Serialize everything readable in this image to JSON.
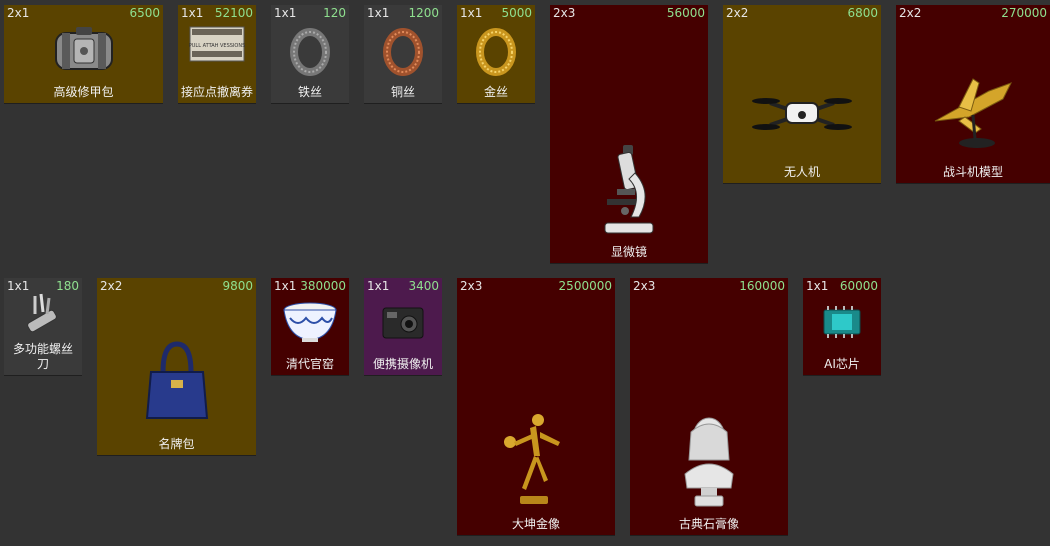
{
  "items": [
    {
      "id": "armor-repair-kit",
      "size": "2x1",
      "price": "6500",
      "name": "高级修甲包",
      "tier": "gold",
      "icon": "armor-repair-kit-icon"
    },
    {
      "id": "extraction-voucher",
      "size": "1x1",
      "price": "52100",
      "name": "接应点撤离券",
      "tier": "gold",
      "icon": "voucher-icon",
      "icon_text": "PULL ATTAH VESSIONS"
    },
    {
      "id": "iron-wire",
      "size": "1x1",
      "price": "120",
      "name": "铁丝",
      "tier": "gray",
      "icon": "iron-wire-icon"
    },
    {
      "id": "copper-wire",
      "size": "1x1",
      "price": "1200",
      "name": "铜丝",
      "tier": "gray",
      "icon": "copper-wire-icon"
    },
    {
      "id": "gold-wire",
      "size": "1x1",
      "price": "5000",
      "name": "金丝",
      "tier": "gold",
      "icon": "gold-wire-icon"
    },
    {
      "id": "microscope",
      "size": "2x3",
      "price": "56000",
      "name": "显微镜",
      "tier": "red",
      "icon": "microscope-icon"
    },
    {
      "id": "drone",
      "size": "2x2",
      "price": "6800",
      "name": "无人机",
      "tier": "gold",
      "icon": "drone-icon"
    },
    {
      "id": "fighter-model",
      "size": "2x2",
      "price": "270000",
      "name": "战斗机模型",
      "tier": "red",
      "icon": "fighter-jet-icon"
    },
    {
      "id": "multitool",
      "size": "1x1",
      "price": "180",
      "name": "多功能螺丝刀",
      "tier": "gray",
      "icon": "multitool-icon"
    },
    {
      "id": "handbag",
      "size": "2x2",
      "price": "9800",
      "name": "名牌包",
      "tier": "gold",
      "icon": "handbag-icon"
    },
    {
      "id": "porcelain-bowl",
      "size": "1x1",
      "price": "380000",
      "name": "清代官窑",
      "tier": "red",
      "icon": "porcelain-bowl-icon"
    },
    {
      "id": "action-camera",
      "size": "1x1",
      "price": "3400",
      "name": "便携摄像机",
      "tier": "purple",
      "icon": "action-camera-icon"
    },
    {
      "id": "golden-statue",
      "size": "2x3",
      "price": "2500000",
      "name": "大坤金像",
      "tier": "red",
      "icon": "golden-statue-icon"
    },
    {
      "id": "plaster-bust",
      "size": "2x3",
      "price": "160000",
      "name": "古典石膏像",
      "tier": "red",
      "icon": "plaster-bust-icon"
    },
    {
      "id": "ai-chip",
      "size": "1x1",
      "price": "60000",
      "name": "AI芯片",
      "tier": "red",
      "icon": "ai-chip-icon"
    }
  ],
  "colors": {
    "background": "#333333",
    "tier_gold": "#5a4300",
    "tier_red": "#450000",
    "tier_gray": "#3a3a3a",
    "tier_purple": "#4d1a4d",
    "price_text": "#8fe08f"
  }
}
